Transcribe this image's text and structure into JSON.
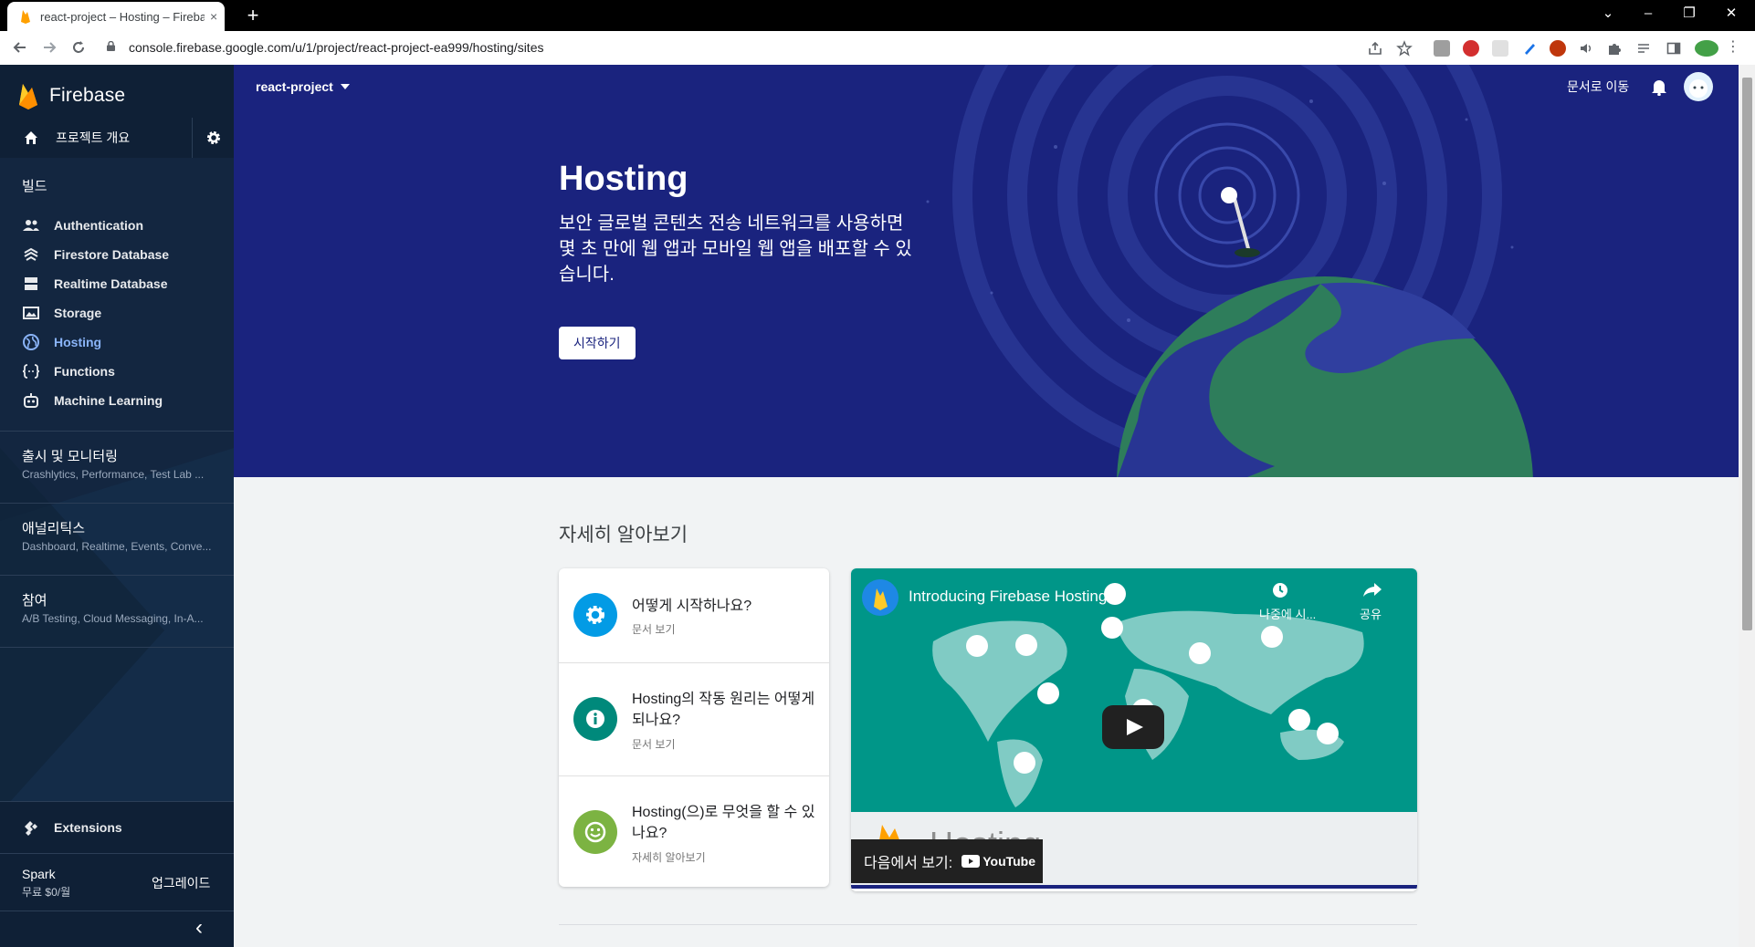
{
  "browser": {
    "tab_title": "react-project – Hosting – Firebase",
    "tab_close": "×",
    "new_tab": "+",
    "url": "console.firebase.google.com/u/1/project/react-project-ea999/hosting/sites",
    "window_controls": [
      "⌄",
      "–",
      "❐",
      "✕"
    ],
    "icons": [
      "back-arrow-icon",
      "forward-arrow-icon",
      "reload-icon",
      "lock-icon",
      "share-icon",
      "star-icon"
    ]
  },
  "sidebar": {
    "brand": "Firebase",
    "overview_label": "프로젝트 개요",
    "build_section": "빌드",
    "build_items": [
      {
        "label": "Authentication",
        "icon": "people-icon"
      },
      {
        "label": "Firestore Database",
        "icon": "firestore-icon"
      },
      {
        "label": "Realtime Database",
        "icon": "database-icon"
      },
      {
        "label": "Storage",
        "icon": "image-icon"
      },
      {
        "label": "Hosting",
        "icon": "globe-icon",
        "active": true
      },
      {
        "label": "Functions",
        "icon": "functions-icon"
      },
      {
        "label": "Machine Learning",
        "icon": "robot-icon"
      }
    ],
    "groups": [
      {
        "title": "출시 및 모니터링",
        "subtitle": "Crashlytics, Performance, Test Lab ..."
      },
      {
        "title": "애널리틱스",
        "subtitle": "Dashboard, Realtime, Events, Conve..."
      },
      {
        "title": "참여",
        "subtitle": "A/B Testing, Cloud Messaging, In-A..."
      }
    ],
    "extensions_label": "Extensions",
    "plan_name": "Spark",
    "plan_price": "무료 $0/월",
    "upgrade_label": "업그레이드",
    "collapse_glyph": "‹"
  },
  "header": {
    "project_name": "react-project",
    "docs_link": "문서로 이동"
  },
  "hero": {
    "title": "Hosting",
    "description": "보안 글로벌 콘텐츠 전송 네트워크를 사용하면 몇 초 만에 웹 앱과 모바일 웹 앱을 배포할 수 있습니다.",
    "start_button": "시작하기"
  },
  "learn_more": {
    "title": "자세히 알아보기",
    "cards": [
      {
        "title": "어떻게 시작하나요?",
        "link": "문서 보기",
        "icon": "gear-icon",
        "color": "#039be5"
      },
      {
        "title": "Hosting의 작동 원리는 어떻게 되나요?",
        "link": "문서 보기",
        "icon": "info-icon",
        "color": "#00897b"
      },
      {
        "title": "Hosting(으)로 무엇을 할 수 있나요?",
        "link": "자세히 알아보기",
        "icon": "smiley-icon",
        "color": "#7cb342"
      }
    ]
  },
  "video": {
    "title": "Introducing Firebase Hosting",
    "watch_later": "나중에 시...",
    "share": "공유",
    "watch_on": "다음에서 보기:",
    "youtube": "YouTube",
    "logo_text": "Hosting"
  },
  "colors": {
    "hero_bg": "#1a237e",
    "sidebar_bg": "#132640",
    "active_blue": "#8ab4f8",
    "video_bg": "#009688"
  }
}
